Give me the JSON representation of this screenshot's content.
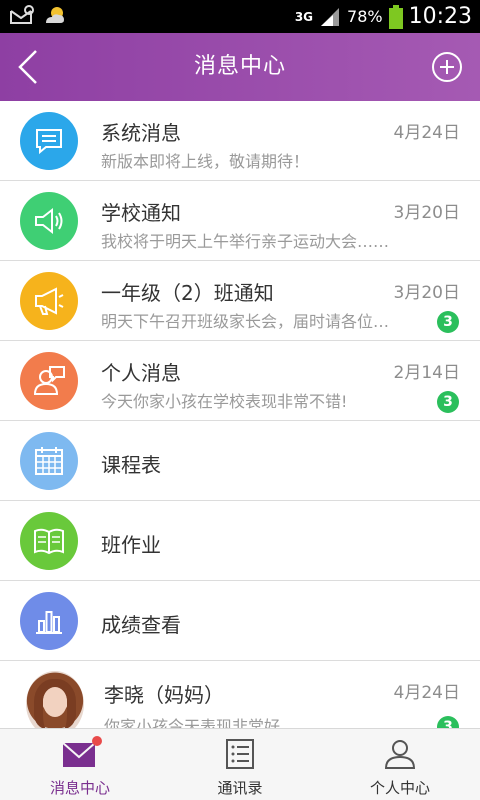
{
  "status_bar": {
    "network": "3G",
    "battery": "78%",
    "time": "10:23"
  },
  "header": {
    "title": "消息中心"
  },
  "colors": {
    "header_purple": "#9a4cac",
    "badge_green": "#2bbf5c"
  },
  "items": [
    {
      "name": "系统消息",
      "preview": "新版本即将上线，敬请期待！",
      "date": "4月24日",
      "badge": "",
      "color": "#2ba7ea",
      "icon": "chat-bubble-icon"
    },
    {
      "name": "学校通知",
      "preview": "我校将于明天上午举行亲子运动大会……",
      "date": "3月20日",
      "badge": "",
      "color": "#3fcf74",
      "icon": "speaker-icon"
    },
    {
      "name": "一年级（2）班通知",
      "preview": "明天下午召开班级家长会，届时请各位…",
      "date": "3月20日",
      "badge": "3",
      "color": "#f6b31c",
      "icon": "megaphone-icon"
    },
    {
      "name": "个人消息",
      "preview": "今天你家小孩在学校表现非常不错!",
      "date": "2月14日",
      "badge": "3",
      "color": "#f27c4c",
      "icon": "person-message-icon"
    },
    {
      "name": "课程表",
      "preview": "",
      "date": "",
      "badge": "",
      "color": "#7eb9f0",
      "icon": "calendar-icon"
    },
    {
      "name": "班作业",
      "preview": "",
      "date": "",
      "badge": "",
      "color": "#69c93b",
      "icon": "book-icon"
    },
    {
      "name": "成绩查看",
      "preview": "",
      "date": "",
      "badge": "",
      "color": "#6f8ce8",
      "icon": "bar-chart-icon"
    },
    {
      "name": "李晓（妈妈）",
      "preview": "你家小孩今天表现非常好……",
      "date": "4月24日",
      "badge": "3",
      "color": "",
      "icon": "user-photo"
    }
  ],
  "tabs": [
    {
      "label": "消息中心",
      "icon": "envelope-icon",
      "active": true
    },
    {
      "label": "通讯录",
      "icon": "contacts-list-icon",
      "active": false
    },
    {
      "label": "个人中心",
      "icon": "user-icon",
      "active": false
    }
  ]
}
